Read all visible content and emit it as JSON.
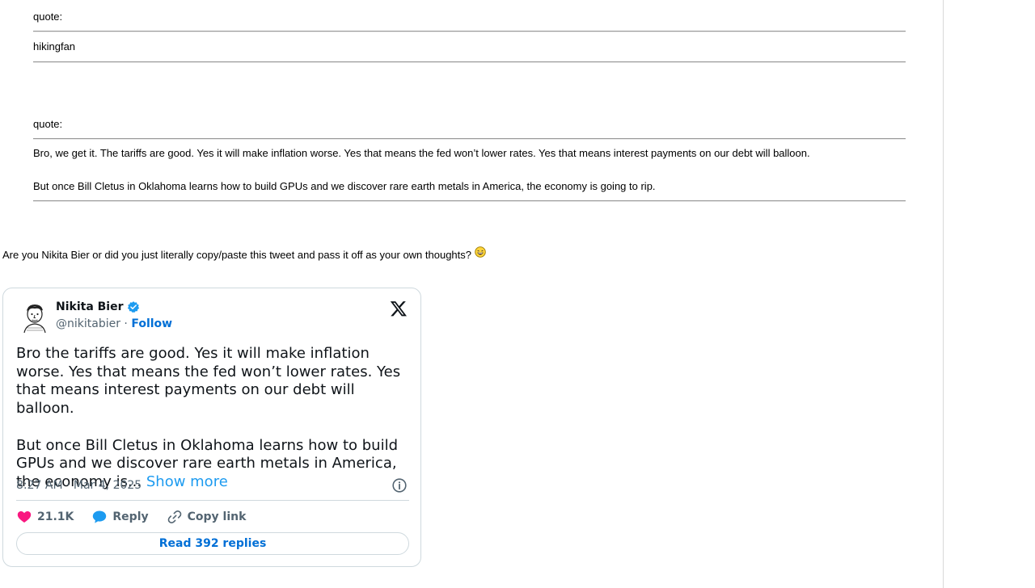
{
  "quotes": [
    {
      "label": "quote:",
      "body": "hikingfan"
    },
    {
      "label": "quote:",
      "paragraphs": [
        "Bro, we get it. The tariffs are good. Yes it will make inflation worse. Yes that means the fed won’t lower rates. Yes that means interest payments on our debt will balloon.",
        "But once Bill Cletus in Oklahoma learns how to build GPUs and we discover rare earth metals in America, the economy is going to rip."
      ]
    }
  ],
  "post": {
    "text": "Are you Nikita Bier or did you just literally copy/paste this tweet and pass it off as your own thoughts?",
    "emoji": "laughing-emoji"
  },
  "tweet": {
    "author_name": "Nikita Bier",
    "handle": "@nikitabier",
    "handle_separator": " · ",
    "follow_label": "Follow",
    "paragraphs": [
      "Bro the tariffs are good. Yes it will make inflation worse. Yes that means the fed won’t lower rates. Yes that means interest payments on our debt will balloon.",
      "But once Bill Cletus in Oklahoma learns how to build GPUs and we discover rare earth metals in America, the economy is..."
    ],
    "show_more_label": "Show more",
    "timestamp": "8:27 AM · Mar 4, 2025",
    "like_count": "21.1K",
    "reply_label": "Reply",
    "copy_link_label": "Copy link",
    "read_replies_label": "Read 392 replies",
    "icons": {
      "logo": "x-logo-icon",
      "verified": "verified-badge-icon",
      "info": "info-icon",
      "like": "heart-icon",
      "reply": "reply-bubble-icon",
      "copy_link": "link-icon"
    },
    "colors": {
      "link": "#1d9bf0",
      "follow": "#006fd6",
      "heart": "#f91880",
      "border": "#cfd9de",
      "muted": "#536471"
    }
  }
}
